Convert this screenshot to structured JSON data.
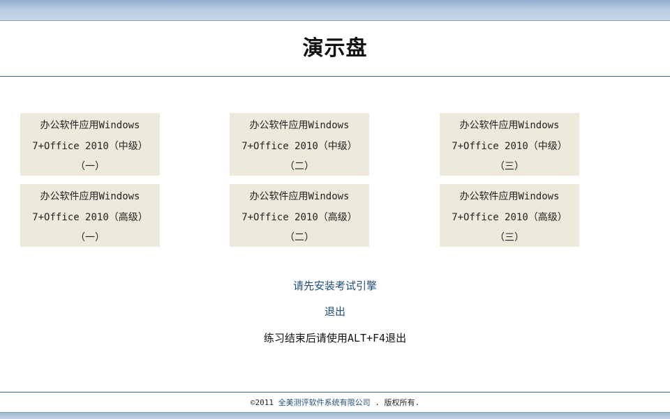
{
  "page": {
    "title": "演示盘"
  },
  "tiles": [
    {
      "line1": "办公软件应用Windows",
      "line2": "7+Office 2010（中级）",
      "line3": "（一）"
    },
    {
      "line1": "办公软件应用Windows",
      "line2": "7+Office 2010（中级）",
      "line3": "（二）"
    },
    {
      "line1": "办公软件应用Windows",
      "line2": "7+Office 2010（中级）",
      "line3": "（三）"
    },
    {
      "line1": "办公软件应用Windows",
      "line2": "7+Office 2010（高级）",
      "line3": "（一）"
    },
    {
      "line1": "办公软件应用Windows",
      "line2": "7+Office 2010（高级）",
      "line3": "（二）"
    },
    {
      "line1": "办公软件应用Windows",
      "line2": "7+Office 2010（高级）",
      "line3": "（三）"
    }
  ],
  "actions": {
    "install_engine": "请先安装考试引擎",
    "exit": "退出",
    "hint": "练习结束后请使用ALT+F4退出"
  },
  "footer": {
    "copyright": "©2011",
    "company": "全美测评软件系统有限公司",
    "rights": " . 版权所有."
  },
  "colors": {
    "tile_background": "#eeeadb",
    "link": "#1f4e79",
    "header_band": "#b7cbe0",
    "rule": "#3f6b8a"
  }
}
